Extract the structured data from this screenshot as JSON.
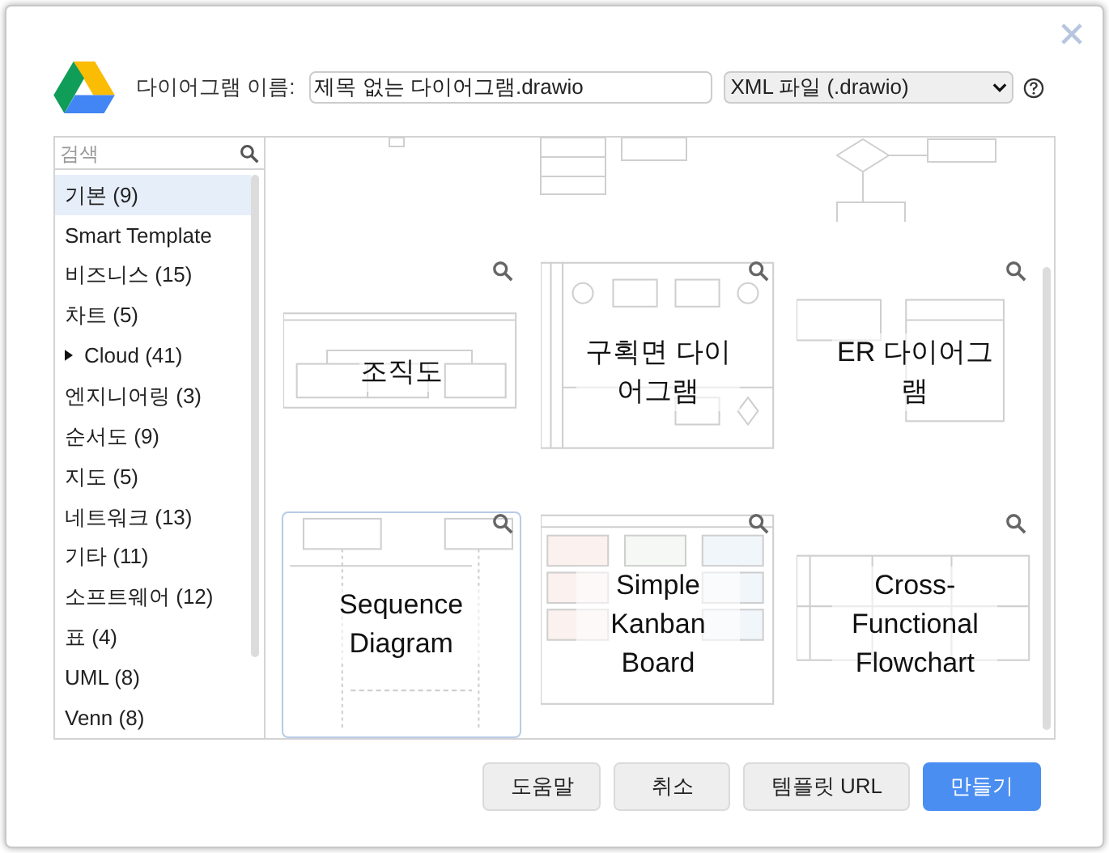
{
  "dialog": {
    "name_label": "다이어그램 이름:",
    "name_value": "제목 없는 다이어그램.drawio",
    "format": "XML 파일 (.drawio)"
  },
  "search": {
    "placeholder": "검색"
  },
  "categories": [
    {
      "label": "기본 (9)",
      "selected": true
    },
    {
      "label": "Smart Template",
      "selected": false
    },
    {
      "label": "비즈니스 (15)",
      "selected": false
    },
    {
      "label": "차트 (5)",
      "selected": false
    },
    {
      "label": "Cloud (41)",
      "selected": false,
      "expandable": true
    },
    {
      "label": "엔지니어링 (3)",
      "selected": false
    },
    {
      "label": "순서도 (9)",
      "selected": false
    },
    {
      "label": "지도 (5)",
      "selected": false
    },
    {
      "label": "네트워크 (13)",
      "selected": false
    },
    {
      "label": "기타 (11)",
      "selected": false
    },
    {
      "label": "소프트웨어 (12)",
      "selected": false
    },
    {
      "label": "표 (4)",
      "selected": false
    },
    {
      "label": "UML (8)",
      "selected": false
    },
    {
      "label": "Venn (8)",
      "selected": false
    }
  ],
  "top_row": [
    {
      "kind": "blank"
    },
    {
      "kind": "table"
    },
    {
      "kind": "flow"
    }
  ],
  "templates": [
    {
      "name": "조직도",
      "kind": "org",
      "selected": false
    },
    {
      "name": "구획면 다이어그램",
      "kind": "swimlane",
      "selected": false
    },
    {
      "name": "ER 다이어그램",
      "kind": "er",
      "selected": false
    },
    {
      "name": "Sequence Diagram",
      "kind": "sequence",
      "selected": true
    },
    {
      "name": "Simple Kanban Board",
      "kind": "kanban",
      "selected": false
    },
    {
      "name": "Cross-Functional Flowchart",
      "kind": "crossfunc",
      "selected": false
    }
  ],
  "buttons": [
    {
      "label": "도움말",
      "kind": "plain"
    },
    {
      "label": "취소",
      "kind": "plain"
    },
    {
      "label": "템플릿 URL",
      "kind": "plain"
    },
    {
      "label": "만들기",
      "kind": "primary"
    }
  ]
}
